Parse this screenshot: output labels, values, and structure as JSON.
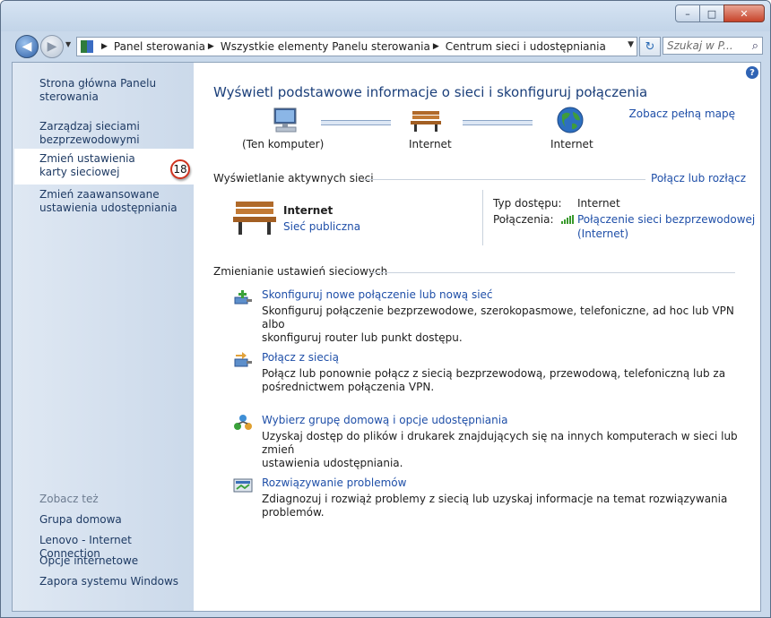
{
  "window": {
    "minimize": "–",
    "maximize": "□",
    "close": "✕"
  },
  "address": {
    "crumbs": [
      "Panel sterowania",
      "Wszystkie elementy Panelu sterowania",
      "Centrum sieci i udostępniania"
    ],
    "search_placeholder": "Szukaj w P..."
  },
  "sidebar": {
    "items": [
      {
        "label": "Strona główna Panelu sterowania"
      },
      {
        "label": "Zarządzaj sieciami bezprzewodowymi"
      },
      {
        "label": "Zmień ustawienia karty sieciowej"
      },
      {
        "label": "Zmień zaawansowane ustawienia udostępniania"
      }
    ],
    "badge": "18",
    "see_also_title": "Zobacz też",
    "see_also": [
      "Grupa domowa",
      "Lenovo - Internet Connection",
      "Opcje internetowe",
      "Zapora systemu Windows"
    ]
  },
  "main": {
    "title": "Wyświetl podstawowe informacje o sieci i skonfiguruj połączenia",
    "map_link": "Zobacz pełną mapę",
    "nodes": [
      "(Ten komputer)",
      "Internet",
      "Internet"
    ],
    "active_header": "Wyświetlanie aktywnych sieci",
    "connect_link": "Połącz lub rozłącz",
    "network": {
      "name": "Internet",
      "type": "Sieć publiczna"
    },
    "access_label": "Typ dostępu:",
    "access_value": "Internet",
    "connections_label": "Połączenia:",
    "connection_value_1": "Połączenie sieci bezprzewodowej",
    "connection_value_2": "(Internet)",
    "change_header": "Zmienianie ustawień sieciowych",
    "tasks": [
      {
        "title": "Skonfiguruj nowe połączenie lub nową sieć",
        "desc1": "Skonfiguruj połączenie bezprzewodowe, szerokopasmowe, telefoniczne, ad hoc lub VPN albo",
        "desc2": "skonfiguruj router lub punkt dostępu."
      },
      {
        "title": "Połącz z siecią",
        "desc1": "Połącz lub ponownie połącz z siecią bezprzewodową, przewodową, telefoniczną lub za",
        "desc2": "pośrednictwem połączenia VPN."
      },
      {
        "title": "Wybierz grupę domową i opcje udostępniania",
        "desc1": "Uzyskaj dostęp do plików i drukarek znajdujących się na innych komputerach w sieci lub zmień",
        "desc2": "ustawienia udostępniania."
      },
      {
        "title": "Rozwiązywanie problemów",
        "desc1": "Zdiagnozuj i rozwiąż problemy z siecią lub uzyskaj informacje na temat rozwiązywania problemów.",
        "desc2": ""
      }
    ]
  }
}
